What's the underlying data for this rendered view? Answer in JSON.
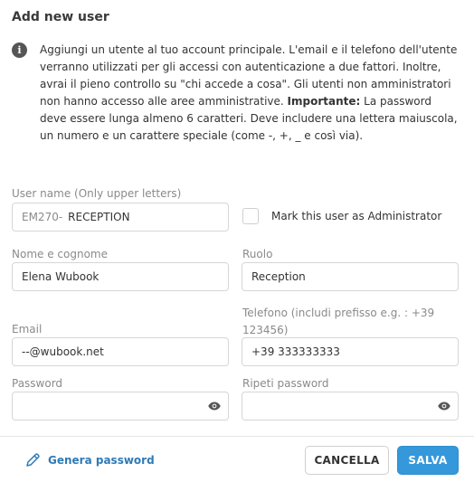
{
  "dialog": {
    "title": "Add new user"
  },
  "info": {
    "text": "Aggiungi un utente al tuo account principale. L'email e il telefono dell'utente verranno utilizzati per gli accessi con autenticazione a due fattori. Inoltre, avrai il pieno controllo su \"chi accede a cosa\". Gli utenti non amministratori non hanno accesso alle aree amministrative.",
    "important_label": "Importante:",
    "important_text": " La password deve essere lunga almeno 6 caratteri. Deve includere una lettera maiuscola, un numero e un carattere speciale (come -, +, _ e così via)."
  },
  "form": {
    "username": {
      "label": "User name (Only upper letters)",
      "prefix": "EM270-",
      "value": "RECEPTION"
    },
    "admin": {
      "label": "Mark this user as Administrator",
      "checked": false
    },
    "fullname": {
      "label": "Nome e cognome",
      "value": "Elena Wubook"
    },
    "role": {
      "label": "Ruolo",
      "value": "Reception"
    },
    "email": {
      "label": "Email",
      "value": "--@wubook.net"
    },
    "phone": {
      "label": "Telefono (includi prefisso e.g. : +39 123456)",
      "value": "+39 333333333"
    },
    "password": {
      "label": "Password",
      "value": ""
    },
    "repeat_password": {
      "label": "Ripeti password",
      "value": ""
    }
  },
  "footer": {
    "generate_label": "Genera password",
    "cancel_label": "CANCELLA",
    "save_label": "SALVA"
  },
  "colors": {
    "accent": "#3498db",
    "link": "#2f7ab6"
  }
}
